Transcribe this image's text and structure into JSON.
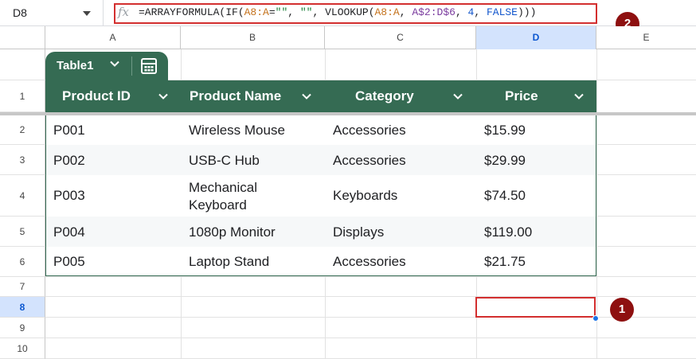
{
  "formula_bar": {
    "name_box": "D8",
    "fx_label": "fx",
    "formula_parts": [
      {
        "t": "=ARRAYFORMULA(IF(",
        "c": "plain"
      },
      {
        "t": "A8:A",
        "c": "ref"
      },
      {
        "t": "=",
        "c": "plain"
      },
      {
        "t": "\"\"",
        "c": "str"
      },
      {
        "t": ", ",
        "c": "plain"
      },
      {
        "t": "\"\"",
        "c": "str"
      },
      {
        "t": ", VLOOKUP(",
        "c": "plain"
      },
      {
        "t": "A8:A",
        "c": "ref"
      },
      {
        "t": ", ",
        "c": "plain"
      },
      {
        "t": "A$2:D$6",
        "c": "ref2"
      },
      {
        "t": ", ",
        "c": "plain"
      },
      {
        "t": "4",
        "c": "num"
      },
      {
        "t": ", ",
        "c": "plain"
      },
      {
        "t": "FALSE",
        "c": "num"
      },
      {
        "t": ")))",
        "c": "plain"
      }
    ]
  },
  "columns": [
    "A",
    "B",
    "C",
    "D",
    "E"
  ],
  "rows": [
    "1",
    "2",
    "3",
    "4",
    "5",
    "6",
    "7",
    "8",
    "9",
    "10"
  ],
  "table": {
    "name": "Table1",
    "headers": [
      "Product ID",
      "Product Name",
      "Category",
      "Price"
    ],
    "data": [
      [
        "P001",
        "Wireless Mouse",
        "Accessories",
        "$15.99"
      ],
      [
        "P002",
        "USB-C Hub",
        "Accessories",
        "$29.99"
      ],
      [
        "P003",
        "Mechanical Keyboard",
        "Keyboards",
        "$74.50"
      ],
      [
        "P004",
        "1080p Monitor",
        "Displays",
        "$119.00"
      ],
      [
        "P005",
        "Laptop Stand",
        "Accessories",
        "$21.75"
      ]
    ],
    "header_color": "#356b53"
  },
  "selection": {
    "cell": "D8",
    "highlight_color": "#d32f2f"
  },
  "badges": {
    "one": "1",
    "two": "2",
    "color": "#8e1010"
  },
  "icons": {
    "table_menu": "chevron-down-icon",
    "table_calc": "calculator-icon"
  }
}
